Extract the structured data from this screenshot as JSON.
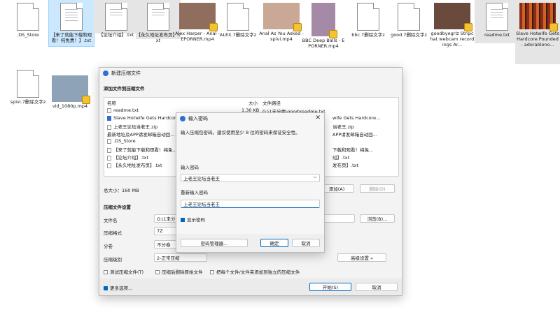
{
  "desktop": {
    "files": [
      {
        "name": ".DS_Store",
        "kind": "doc"
      },
      {
        "name": "【来了就能下载和观看！纯免费！】.txt",
        "kind": "doc"
      },
      {
        "name": "【论坛介绍】.txt",
        "kind": "doc"
      },
      {
        "name": "【永久地址发布页】.txt",
        "kind": "doc"
      },
      {
        "name": "Alex Harper - Anal - EPORNER.mp4",
        "kind": "video"
      },
      {
        "name": "ALEX.7删除文字z",
        "kind": "doc"
      },
      {
        "name": "Anal As You Asked - spivi.mp4",
        "kind": "video"
      },
      {
        "name": "BBC Deep Balls - EPORNER.mp4",
        "kind": "video"
      },
      {
        "name": "bbc.7删除文字z",
        "kind": "doc"
      },
      {
        "name": "good.7删除文字z",
        "kind": "doc"
      },
      {
        "name": "goodbyegrlz Stripchat webcam recordings Ar...",
        "kind": "video"
      },
      {
        "name": "readme.txt",
        "kind": "doc"
      },
      {
        "name": "Slave Hotwife Gets Hardcore Pounded - adorableno...",
        "kind": "video"
      },
      {
        "name": "spivi.7删除文字z",
        "kind": "doc"
      },
      {
        "name": "vid_1080p.mp4",
        "kind": "video"
      }
    ]
  },
  "archive_dialog": {
    "title": "新建压缩文件",
    "section_add": "添加文件到压缩文件",
    "col_name": "名称",
    "col_size": "大小",
    "col_path": "文件路径",
    "rows": [
      {
        "name": "readme.txt",
        "size": "1.30 KB",
        "path": "G:\\1未分类\\good\\readme.txt"
      },
      {
        "name": "Slave Hotwife Gets Hardcore...",
        "size": "",
        "path": "wife Gets Hardcore..."
      },
      {
        "name": "上老王论坛当老王.zip",
        "size": "",
        "path": "当老王.zip"
      },
      {
        "name": "最新地址及APP请发邮箱自动回...",
        "size": "",
        "path": "APP请发邮箱自动回..."
      },
      {
        "name": ".DS_Store",
        "size": "",
        "path": ""
      },
      {
        "name": "【来了就能下载和观看！纯免...",
        "size": "",
        "path": "下载和观看！纯免..."
      },
      {
        "name": "【论坛介绍】.txt",
        "size": "",
        "path": "绍】.txt"
      },
      {
        "name": "【永久地址发布页】.txt",
        "size": "",
        "path": "发布页】.txt"
      }
    ],
    "total_size": "总大小：160 MB",
    "add_button": "添加(A)",
    "delete_button": "删除(D)",
    "settings_title": "压缩文件设置",
    "filename_label": "文件名",
    "filename_value": "G:\\1未分",
    "browse_button": "浏览(B)...",
    "format_label": "压缩格式",
    "format_value": "7Z",
    "split_label": "分卷",
    "split_value": "不分卷",
    "level_label": "压缩级别",
    "level_value": "2-正常压缩",
    "advanced_button": "高级设置 »",
    "test_check": "测试压缩文件(T)",
    "delete_after_check": "压缩后删除原始文件",
    "separate_check": "把每个文件/文件夹添加到独立的压缩文件",
    "more_options": "更多选项...",
    "start_button": "开始(S)",
    "cancel_button": "取消"
  },
  "password_dialog": {
    "title": "输入密码",
    "hint": "输入压缩包密码。建议使用至少 8 位的密码来保证安全性。",
    "enter_label": "输入密码",
    "enter_value": "上老王论坛当老王",
    "reenter_label": "重新输入密码",
    "reenter_value": "上老王论坛当老王",
    "show_password": "显示密码",
    "manager_button": "密码管理器...",
    "ok_button": "确定",
    "cancel_button": "取消"
  }
}
